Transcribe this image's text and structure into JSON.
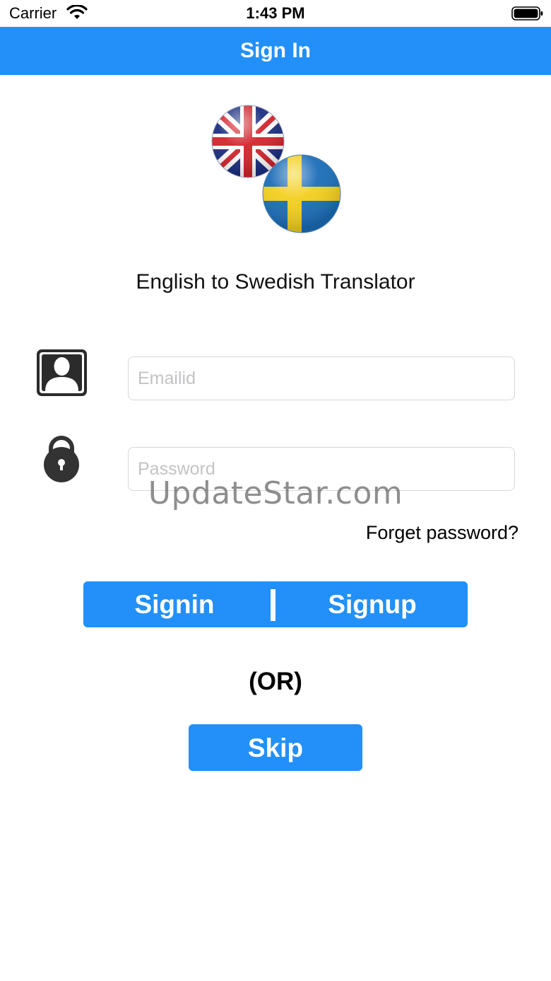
{
  "status_bar": {
    "carrier": "Carrier",
    "time": "1:43 PM",
    "wifi_icon": "wifi-icon",
    "battery_icon": "battery-icon"
  },
  "nav": {
    "title": "Sign In",
    "background_color": "#2290f8"
  },
  "logo": {
    "icon": "uk-sweden-flags-logo"
  },
  "app_title": "English to Swedish Translator",
  "form": {
    "user_icon": "user-icon",
    "lock_icon": "lock-icon",
    "email": {
      "placeholder": "Emailid",
      "value": ""
    },
    "password": {
      "placeholder": "Password",
      "value": ""
    }
  },
  "watermark": "UpdateStar.com",
  "forget_password": "Forget password?",
  "auth": {
    "signin_label": "Signin",
    "signup_label": "Signup"
  },
  "or_label": "(OR)",
  "skip_label": "Skip",
  "colors": {
    "accent": "#2290f8",
    "text": "#000000"
  }
}
